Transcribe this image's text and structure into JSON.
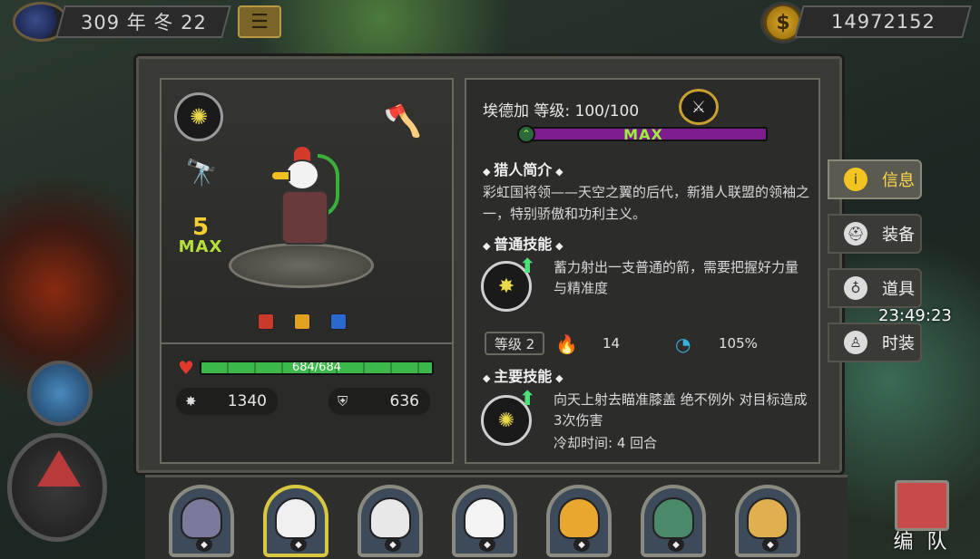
{
  "topbar": {
    "date": "309 年 冬 22",
    "gold": "14972152"
  },
  "hero": {
    "name_level": "埃德加  等级: 100/100",
    "max_label": "MAX",
    "star_number": "5",
    "star_max": "MAX",
    "hp": "684/684",
    "hp_fraction": 1.0,
    "attack": "1340",
    "defense": "636"
  },
  "info": {
    "intro_title": "猎人简介",
    "intro_text": "彩虹国将领——天空之翼的后代，新猎人联盟的领袖之一，特别骄傲和功利主义。",
    "normal_title": "普通技能",
    "normal_text": "蓄力射出一支普通的箭，需要把握好力量与精准度",
    "skill_level": "等级 2",
    "fire_value": "14",
    "swirl_value": "105%",
    "main_title": "主要技能",
    "main_text": "向天上射去瞄准膝盖 绝不例外 对目标造成3次伤害",
    "cooldown": "冷却时间: 4 回合"
  },
  "tabs": [
    {
      "label": "信息",
      "icon": "info-icon"
    },
    {
      "label": "装备",
      "icon": "helmet-icon"
    },
    {
      "label": "道具",
      "icon": "bag-icon"
    },
    {
      "label": "时装",
      "icon": "shirt-icon"
    }
  ],
  "clock": "23:49:23",
  "team_button": "编 队",
  "colors": {
    "hp_green": "#3cb84a",
    "level_purple": "#7d1c8c",
    "max_text": "#9af03a",
    "active_tab": "#ffd84a"
  }
}
